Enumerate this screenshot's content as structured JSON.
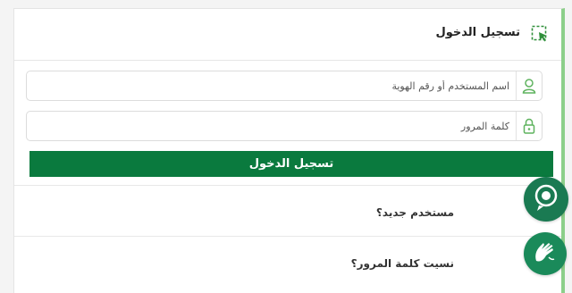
{
  "login_panel": {
    "title": "تسجيل الدخول",
    "username_placeholder": "اسم المستخدم أو رقم الهوية",
    "password_placeholder": "كلمة المرور",
    "submit_label": "تسجيل الدخول",
    "new_user_label": "مستخدم جديد؟",
    "forgot_password_label": "نسيت كلمة المرور؟"
  },
  "icons": {
    "header": "cursor-select-icon",
    "username": "user-icon",
    "password": "lock-icon",
    "chat_fab": "chat-support-icon",
    "sign_fab": "sign-language-icon"
  },
  "colors": {
    "primary": "#0a7a3e",
    "accent": "#8ccf8a",
    "icon_green": "#5fb35f"
  }
}
